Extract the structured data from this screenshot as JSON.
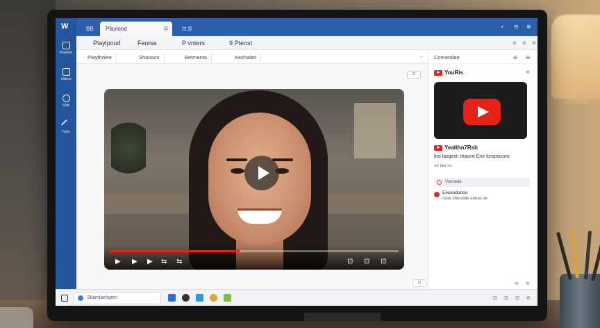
{
  "app": {
    "logo": "W",
    "tabs": [
      {
        "label": "BB"
      },
      {
        "label": "Playlood",
        "close": "⊡"
      },
      {
        "label": "⊡ B"
      }
    ],
    "window_controls": [
      "•",
      "⊖",
      "⊗"
    ]
  },
  "rail": {
    "items": [
      {
        "label": "Playlists"
      },
      {
        "label": "Videos"
      },
      {
        "label": "Stills"
      },
      {
        "label": "Tools"
      }
    ]
  },
  "menu": {
    "items": [
      "Playlpood",
      "Fentsa",
      "P vnters",
      "9 Ptenst"
    ],
    "tools": [
      "⊖",
      "⊖",
      "⊖"
    ]
  },
  "toolbar": {
    "buttons": [
      "Playtholee",
      "Shanson",
      "Betmento",
      "Keshalan"
    ],
    "dropdown": "⌄"
  },
  "main": {
    "top_button": "⊡",
    "bottom_button": "⊡",
    "video": {
      "progress": 0.45,
      "controls": [
        "▶",
        "▶",
        "▶",
        "⇆",
        "⇆"
      ],
      "right_controls": [
        "⊡",
        "⊡",
        "⊡"
      ]
    }
  },
  "panel": {
    "header": "Comendan",
    "header_icons": [
      "⊖",
      "⊖"
    ],
    "brand": "YouRis",
    "brand_icon": "⊖",
    "video_title": "Yealthn7Rsh",
    "video_desc": "foo lasgest: thasne Ene kcopscooo",
    "video_meta": "ce lae ss",
    "comment_placeholder": "Vonnede",
    "comment_author": "Eeceodunoo",
    "comment_text": "cese ohentiole eonas se",
    "footer_icons": [
      "⊖",
      "⊖"
    ]
  },
  "taskbar": {
    "search_placeholder": "Skamlaelspen",
    "tray": [
      "⊡",
      "⊡",
      "⊡",
      "⊖"
    ],
    "colors": {
      "app1": "#2f6fd6",
      "app2": "#333333",
      "app3": "#2b9bd8",
      "app4": "#e8a030",
      "app5": "#7bc043"
    }
  }
}
